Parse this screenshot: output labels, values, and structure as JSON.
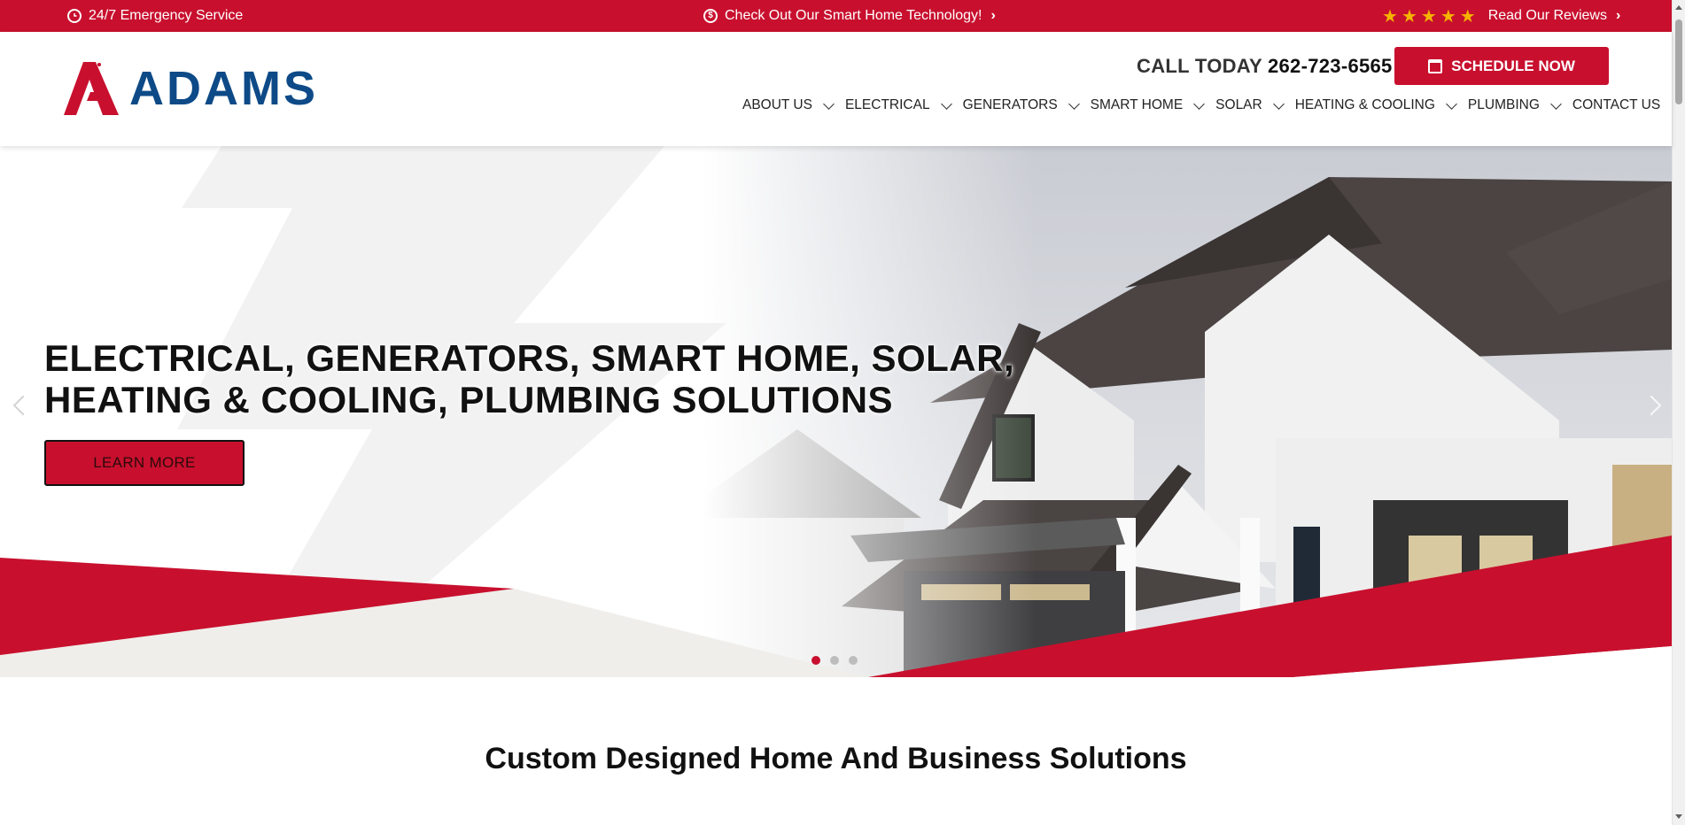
{
  "topbar": {
    "emergency": "24/7 Emergency Service",
    "smart_home": "Check Out Our Smart Home Technology!",
    "reviews": "Read Our Reviews",
    "rating_stars": 5
  },
  "header": {
    "logo_text": "ADAMS",
    "call_label": "CALL TODAY",
    "phone": "262-723-6565",
    "schedule_label": "SCHEDULE NOW"
  },
  "nav": {
    "items": [
      {
        "label": "ABOUT US",
        "has_dropdown": true
      },
      {
        "label": "ELECTRICAL",
        "has_dropdown": true
      },
      {
        "label": "GENERATORS",
        "has_dropdown": true
      },
      {
        "label": "SMART HOME",
        "has_dropdown": true
      },
      {
        "label": "SOLAR",
        "has_dropdown": true
      },
      {
        "label": "HEATING & COOLING",
        "has_dropdown": true
      },
      {
        "label": "PLUMBING",
        "has_dropdown": true
      },
      {
        "label": "CONTACT US",
        "has_dropdown": false
      }
    ]
  },
  "hero": {
    "title_line1": "ELECTRICAL, GENERATORS, SMART HOME, SOLAR,",
    "title_line2": "HEATING & COOLING, PLUMBING SOLUTIONS",
    "button_label": "LEARN MORE",
    "slide_count": 3,
    "active_slide": 1
  },
  "section": {
    "title": "Custom Designed Home And Business Solutions"
  },
  "colors": {
    "brand_red": "#c8102e",
    "brand_blue": "#0d4a87",
    "star": "#f5b400"
  }
}
